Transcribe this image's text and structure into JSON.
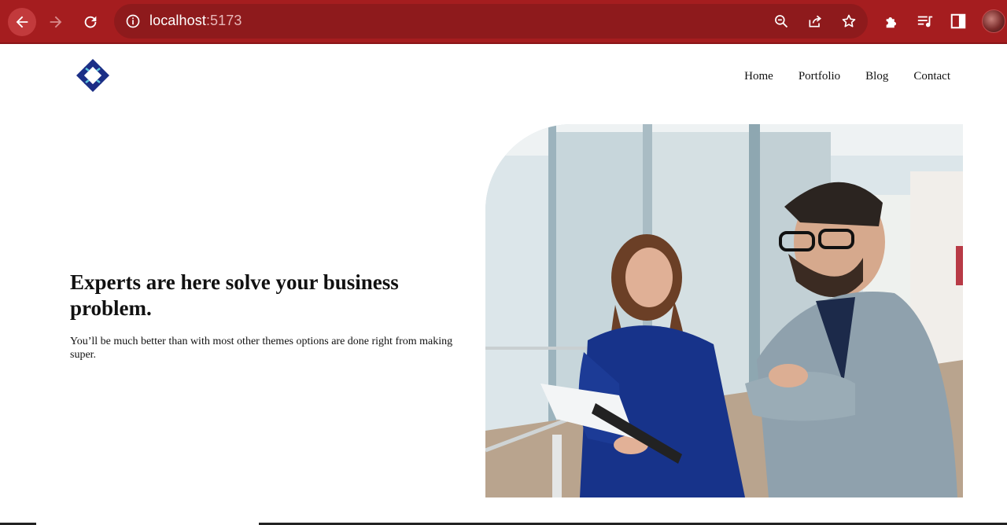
{
  "browser": {
    "url_host": "localhost",
    "url_port": ":5173",
    "icons": [
      "back-arrow-icon",
      "forward-arrow-icon",
      "reload-icon",
      "info-icon",
      "zoom-icon",
      "share-icon",
      "star-icon",
      "extensions-icon",
      "reading-list-icon",
      "side-panel-icon",
      "profile-avatar"
    ]
  },
  "header": {
    "nav": [
      "Home",
      "Portfolio",
      "Blog",
      "Contact"
    ]
  },
  "hero": {
    "title": "Experts are here solve your business problem.",
    "text": "You’ll be much better than with most other themes options are done right from making super."
  },
  "colors": {
    "browser_bar": "#a51d1f",
    "omnibox": "#8e1a1c",
    "logo_blue": "#1b2f86",
    "logo_cyan": "#5fc6dd"
  }
}
